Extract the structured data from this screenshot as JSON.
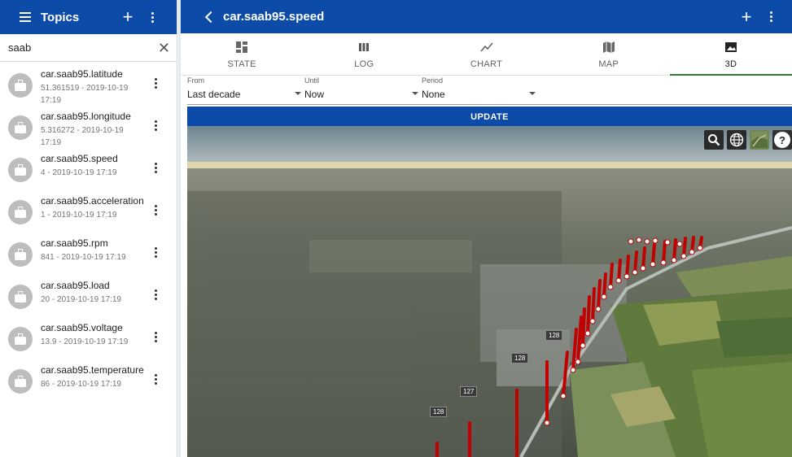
{
  "sidebar": {
    "title": "Topics",
    "search": {
      "value": "saab"
    },
    "items": [
      {
        "name": "car.saab95.latitude",
        "detail": "51.361519 - 2019-10-19 17:19"
      },
      {
        "name": "car.saab95.longitude",
        "detail": "5.316272 - 2019-10-19 17:19"
      },
      {
        "name": "car.saab95.speed",
        "detail": "4 - 2019-10-19 17:19"
      },
      {
        "name": "car.saab95.acceleration",
        "detail": "1 - 2019-10-19 17:19"
      },
      {
        "name": "car.saab95.rpm",
        "detail": "841 - 2019-10-19 17:19"
      },
      {
        "name": "car.saab95.load",
        "detail": "20 - 2019-10-19 17:19"
      },
      {
        "name": "car.saab95.voltage",
        "detail": "13.9 - 2019-10-19 17:19"
      },
      {
        "name": "car.saab95.temperature",
        "detail": "86 - 2019-10-19 17:19"
      }
    ]
  },
  "header": {
    "title": "car.saab95.speed"
  },
  "tabs": [
    {
      "label": "STATE",
      "icon": "dashboard-icon"
    },
    {
      "label": "LOG",
      "icon": "view-columns-icon"
    },
    {
      "label": "CHART",
      "icon": "line-chart-icon"
    },
    {
      "label": "MAP",
      "icon": "map-icon"
    },
    {
      "label": "3D",
      "icon": "image-icon",
      "active": true
    }
  ],
  "filters": {
    "from": {
      "label": "From",
      "value": "Last decade"
    },
    "until": {
      "label": "Until",
      "value": "Now"
    },
    "period": {
      "label": "Period",
      "value": "None"
    }
  },
  "update_label": "UPDATE",
  "map_labels": [
    "128",
    "127",
    "128",
    "128"
  ],
  "colors": {
    "appbar": "#0d4ba8",
    "tab_indicator": "#2e7d32",
    "track": "#c20000"
  }
}
